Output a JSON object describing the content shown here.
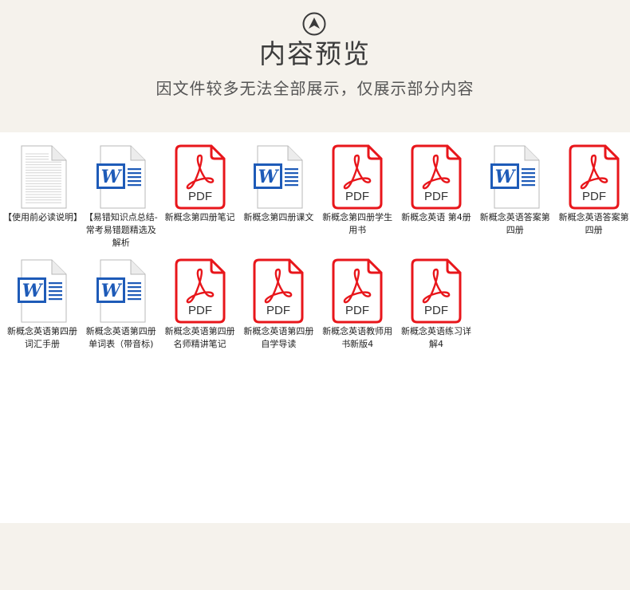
{
  "header": {
    "title": "内容预览",
    "subtitle": "因文件较多无法全部展示，仅展示部分内容",
    "up_icon": "up-arrow-circle-icon"
  },
  "icons": {
    "pdf_text": "PDF",
    "word_letter": "W",
    "pdf_color": "#e8161b",
    "word_color": "#1e5bb8"
  },
  "files": [
    {
      "type": "text",
      "icon": "text-document-icon",
      "label": "【使用前必读说明】"
    },
    {
      "type": "word",
      "icon": "word-document-icon",
      "label": "【易错知识点总结-常考易错题精选及解析"
    },
    {
      "type": "pdf",
      "icon": "pdf-document-icon",
      "label": "新概念第四册笔记"
    },
    {
      "type": "word",
      "icon": "word-document-icon",
      "label": "新概念第四册课文"
    },
    {
      "type": "pdf",
      "icon": "pdf-document-icon",
      "label": "新概念第四册学生用书"
    },
    {
      "type": "pdf",
      "icon": "pdf-document-icon",
      "label": "新概念英语 第4册"
    },
    {
      "type": "word",
      "icon": "word-document-icon",
      "label": "新概念英语答案第四册"
    },
    {
      "type": "pdf",
      "icon": "pdf-document-icon",
      "label": "新概念英语答案第四册"
    },
    {
      "type": "word",
      "icon": "word-document-icon",
      "label": "新概念英语第四册词汇手册"
    },
    {
      "type": "word",
      "icon": "word-document-icon",
      "label": "新概念英语第四册单词表（带音标)"
    },
    {
      "type": "pdf",
      "icon": "pdf-document-icon",
      "label": "新概念英语第四册名师精讲笔记"
    },
    {
      "type": "pdf",
      "icon": "pdf-document-icon",
      "label": "新概念英语第四册自学导读"
    },
    {
      "type": "pdf",
      "icon": "pdf-document-icon",
      "label": "新概念英语教师用书新版4"
    },
    {
      "type": "pdf",
      "icon": "pdf-document-icon",
      "label": "新概念英语练习详解4"
    }
  ]
}
